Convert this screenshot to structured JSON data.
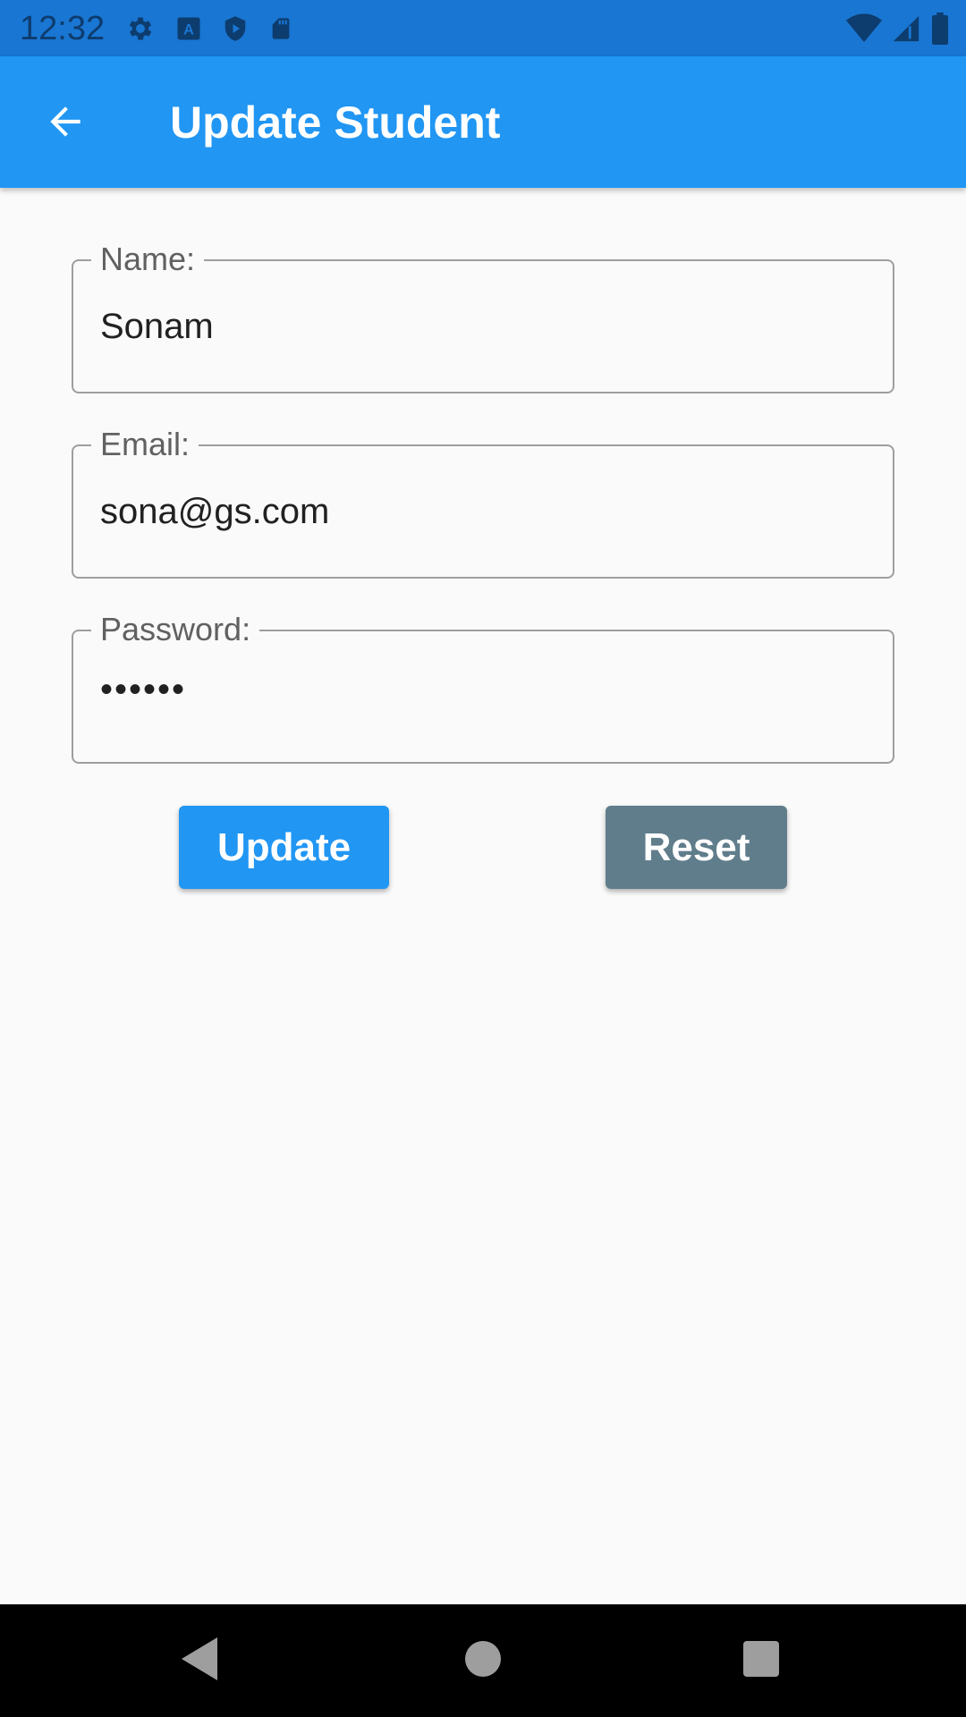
{
  "status_bar": {
    "time": "12:32",
    "icons_left": [
      "gear-icon",
      "text-a-icon",
      "shield-play-icon",
      "sd-card-icon"
    ],
    "icons_right": [
      "wifi-icon",
      "signal-icon",
      "battery-icon"
    ]
  },
  "app_bar": {
    "title": "Update Student",
    "back_icon": "arrow-back-icon",
    "color": "#2196f3"
  },
  "form": {
    "name": {
      "label": "Name:",
      "value": "Sonam"
    },
    "email": {
      "label": "Email:",
      "value": "sona@gs.com"
    },
    "password": {
      "label": "Password:",
      "value": "••••••"
    }
  },
  "buttons": {
    "update_label": "Update",
    "update_color": "#2196f3",
    "reset_label": "Reset",
    "reset_color": "#607d8b"
  },
  "nav_bar": {
    "icons": [
      "nav-back-icon",
      "nav-home-icon",
      "nav-recent-icon"
    ]
  }
}
